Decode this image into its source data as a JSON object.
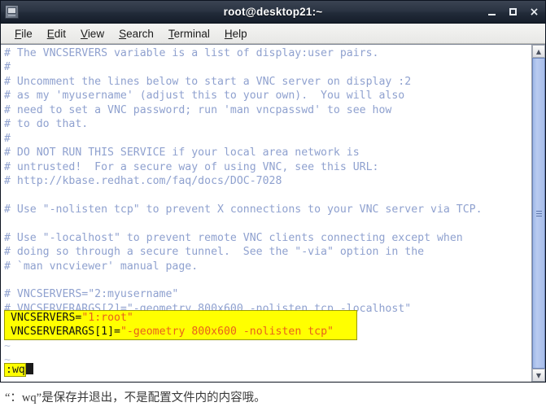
{
  "window": {
    "title": "root@desktop21:~",
    "icon": "terminal-icon",
    "controls": [
      {
        "name": "minimize",
        "glyph": "–"
      },
      {
        "name": "maximize",
        "glyph": "□"
      },
      {
        "name": "close",
        "glyph": "×"
      }
    ]
  },
  "menubar": {
    "items": [
      {
        "mnemonic": "F",
        "rest": "ile"
      },
      {
        "mnemonic": "E",
        "rest": "dit"
      },
      {
        "mnemonic": "V",
        "rest": "iew"
      },
      {
        "mnemonic": "S",
        "rest": "earch"
      },
      {
        "mnemonic": "T",
        "rest": "erminal"
      },
      {
        "mnemonic": "H",
        "rest": "elp"
      }
    ]
  },
  "terminal": {
    "comment_color": "#8fa1cf",
    "background": "#ffffff",
    "lines": [
      "# The VNCSERVERS variable is a list of display:user pairs.",
      "#",
      "# Uncomment the lines below to start a VNC server on display :2",
      "# as my 'myusername' (adjust this to your own).  You will also",
      "# need to set a VNC password; run 'man vncpasswd' to see how",
      "# to do that.",
      "#",
      "# DO NOT RUN THIS SERVICE if your local area network is",
      "# untrusted!  For a secure way of using VNC, see this URL:",
      "# http://kbase.redhat.com/faq/docs/DOC-7028",
      "",
      "# Use \"-nolisten tcp\" to prevent X connections to your VNC server via TCP.",
      "",
      "# Use \"-localhost\" to prevent remote VNC clients connecting except when",
      "# doing so through a secure tunnel.  See the \"-via\" option in the",
      "# `man vncviewer' manual page.",
      "",
      "# VNCSERVERS=\"2:myusername\"",
      "# VNCSERVERARGS[2]=\"-geometry 800x600 -nolisten tcp -localhost\""
    ],
    "tildes": [
      "~",
      "~"
    ],
    "highlight": {
      "background": "#ffff00",
      "border": "#9a9a00",
      "string_color": "#e8601c",
      "rows": [
        {
          "name": "VNCSERVERS=",
          "value": "\"1:root\""
        },
        {
          "name": "VNCSERVERARGS[1]=",
          "value": "\"-geometry 800x600 -nolisten tcp\""
        }
      ]
    },
    "status_line": {
      "command": ":wq",
      "cursor": "block"
    }
  },
  "scrollbar": {
    "up_glyph": "▲",
    "down_glyph": "▼"
  },
  "caption": {
    "text": "“：wq”是保存并退出，不是配置文件内的内容哦。"
  }
}
